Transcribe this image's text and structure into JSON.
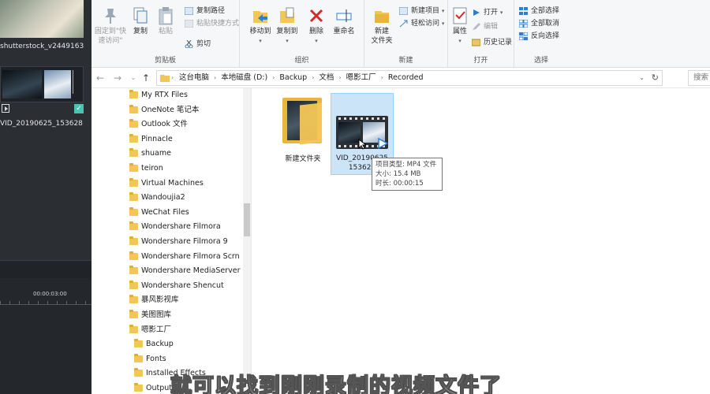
{
  "editor": {
    "clip1_label": "shutterstock_v2449163",
    "clip2_label": "VID_20190625_153628",
    "timecode": "00:00:03:00"
  },
  "ribbon": {
    "clipboard": {
      "label": "剪贴板",
      "pin_quick_access": "固定到\"快\n速访问\"",
      "copy": "复制",
      "paste": "粘贴",
      "copy_path": "复制路径",
      "paste_shortcut": "粘贴快捷方式",
      "cut": "剪切"
    },
    "organize": {
      "label": "组织",
      "move_to": "移动到",
      "copy_to": "复制到",
      "delete": "删除",
      "rename": "重命名"
    },
    "new": {
      "label": "新建",
      "new_folder": "新建\n文件夹",
      "new_item": "新建项目",
      "easy_access": "轻松访问"
    },
    "open": {
      "label": "打开",
      "properties": "属性",
      "open": "打开",
      "edit": "编辑",
      "history": "历史记录"
    },
    "select": {
      "label": "选择",
      "select_all": "全部选择",
      "select_none": "全部取消",
      "invert": "反向选择"
    }
  },
  "address": {
    "crumbs": [
      "这台电脑",
      "本地磁盘 (D:)",
      "Backup",
      "文档",
      "嗯影工厂",
      "Recorded"
    ],
    "search_placeholder": "搜索"
  },
  "nav_tree": [
    {
      "label": "My RTX Files",
      "sub": false
    },
    {
      "label": "OneNote 笔记本",
      "sub": false
    },
    {
      "label": "Outlook 文件",
      "sub": false
    },
    {
      "label": "Pinnacle",
      "sub": false
    },
    {
      "label": "shuame",
      "sub": false
    },
    {
      "label": "teiron",
      "sub": false
    },
    {
      "label": "Virtual Machines",
      "sub": false
    },
    {
      "label": "Wandoujia2",
      "sub": false
    },
    {
      "label": "WeChat Files",
      "sub": false
    },
    {
      "label": "Wondershare Filmora",
      "sub": false
    },
    {
      "label": "Wondershare Filmora 9",
      "sub": false
    },
    {
      "label": "Wondershare Filmora Scrn",
      "sub": false
    },
    {
      "label": "Wondershare MediaServer",
      "sub": false
    },
    {
      "label": "Wondershare Shencut",
      "sub": false
    },
    {
      "label": "暴风影视库",
      "sub": false
    },
    {
      "label": "美图图库",
      "sub": false
    },
    {
      "label": "嗯影工厂",
      "sub": false
    },
    {
      "label": "Backup",
      "sub": true
    },
    {
      "label": "Fonts",
      "sub": true
    },
    {
      "label": "Installed Effects",
      "sub": true
    },
    {
      "label": "Output",
      "sub": true
    }
  ],
  "files": {
    "folder_name": "新建文件夹",
    "video_name_line1": "VID_20190625",
    "video_name_line2": "153628"
  },
  "tooltip": {
    "type": "项目类型: MP4 文件",
    "size": "大小: 15.4 MB",
    "duration": "时长: 00:00:15"
  },
  "caption": "就可以找到刚刚录制的视频文件了",
  "colors": {
    "accent_blue": "#1a73c9",
    "selection": "#cce4f7",
    "folder_yellow": "#f3c756",
    "editor_bg": "#2b2e33",
    "check_teal": "#4cc2b0"
  }
}
